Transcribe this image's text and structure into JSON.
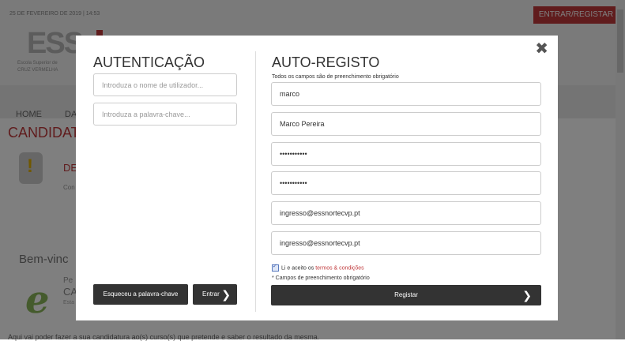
{
  "background": {
    "date": "25 DE FEVEREIRO DE 2019 | 14:53",
    "login_register": "ENTRAR/REGISTAR",
    "logo": "ESS",
    "logo_sub1": "Escola Superior de",
    "logo_sub2": "CRUZ VERMELHA",
    "nav_home": "HOME",
    "nav_da": "DA",
    "heading": "CANDIDAT",
    "de": "DE",
    "con": "Con",
    "welcome": "Bem-vinc",
    "pe": "Pe",
    "ca": "CA",
    "esta": "Esta",
    "footer": "Aqui vai poder fazer a sua candidatura ao(s) curso(s) que pretende e saber o resultado da mesma."
  },
  "modal": {
    "close_symbol": "✖",
    "auth": {
      "title": "AUTENTICAÇÃO",
      "username_placeholder": "Introduza o nome de utilizador...",
      "password_placeholder": "Introduza a palavra-chave...",
      "forgot_label": "Esqueceu a palavra-chave",
      "login_label": "Entrar",
      "login_chevron": "❯"
    },
    "register": {
      "title": "AUTO-REGISTO",
      "required_note": "Todos os campos são de preenchimento obrigatório",
      "fields": [
        {
          "type": "text",
          "value": "marco"
        },
        {
          "type": "text",
          "value": "Marco Pereira"
        },
        {
          "type": "password",
          "value": "password123"
        },
        {
          "type": "password",
          "value": "password123"
        },
        {
          "type": "text",
          "value": "ingresso@essnortecvp.pt"
        },
        {
          "type": "text",
          "value": "ingresso@essnortecvp.pt"
        }
      ],
      "terms_prefix": "Li e aceito os ",
      "terms_link": "termos & condições",
      "terms_checked": true,
      "footer_note": "* Campos de preenchimento obrigatório",
      "submit_label": "Registar",
      "submit_chevron": "❯"
    }
  }
}
